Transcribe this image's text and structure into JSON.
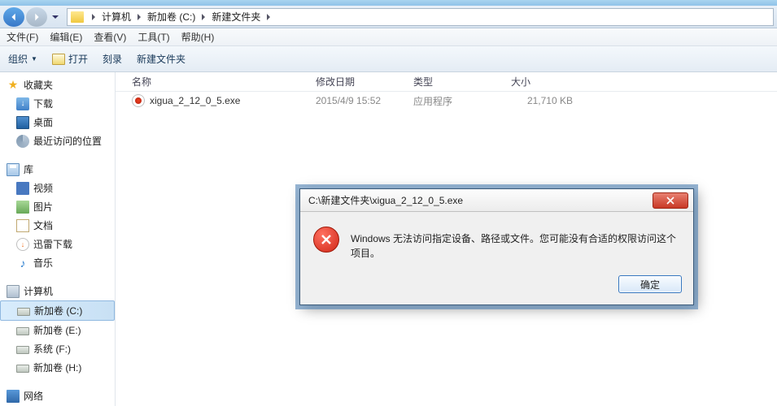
{
  "breadcrumb": {
    "root": "计算机",
    "vol": "新加卷 (C:)",
    "folder": "新建文件夹"
  },
  "menu": {
    "file": "文件(F)",
    "edit": "编辑(E)",
    "view": "查看(V)",
    "tools": "工具(T)",
    "help": "帮助(H)"
  },
  "toolbar": {
    "organize": "组织",
    "open": "打开",
    "burn": "刻录",
    "newfolder": "新建文件夹"
  },
  "sidebar": {
    "fav": "收藏夹",
    "dl": "下载",
    "desktop": "桌面",
    "recent": "最近访问的位置",
    "lib": "库",
    "video": "视频",
    "pic": "图片",
    "doc": "文档",
    "xl": "迅雷下载",
    "music": "音乐",
    "pc": "计算机",
    "drvC": "新加卷 (C:)",
    "drvE": "新加卷 (E:)",
    "drvF": "系统 (F:)",
    "drvH": "新加卷 (H:)",
    "net": "网络"
  },
  "cols": {
    "name": "名称",
    "date": "修改日期",
    "type": "类型",
    "size": "大小"
  },
  "file": {
    "name": "xigua_2_12_0_5.exe",
    "date": "2015/4/9 15:52",
    "type": "应用程序",
    "size": "21,710 KB"
  },
  "dialog": {
    "title": "C:\\新建文件夹\\xigua_2_12_0_5.exe",
    "msg": "Windows 无法访问指定设备、路径或文件。您可能没有合适的权限访问这个项目。",
    "ok": "确定"
  }
}
